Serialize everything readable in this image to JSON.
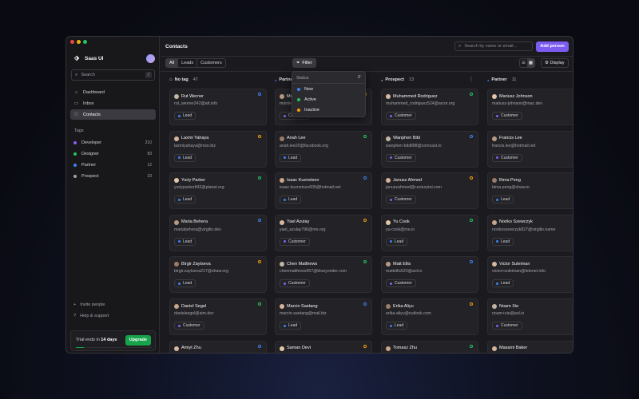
{
  "app": {
    "name": "Saas UI"
  },
  "colors": {
    "primary": "#7c5cf0",
    "upgrade": "#16a34a",
    "developer": "#8b5cf6",
    "designer": "#22c55e",
    "partner": "#3b82f6",
    "prospect": "#a1a1aa",
    "lead": "#3b82f6",
    "customer": "#8b5cf6",
    "status_new": "#3b82f6",
    "status_active": "#22c55e",
    "status_inactive": "#f59e0b"
  },
  "sidebar": {
    "search_placeholder": "Search",
    "search_shortcut": "/",
    "nav": [
      {
        "label": "Dashboard",
        "icon": "home-icon"
      },
      {
        "label": "Inbox",
        "icon": "inbox-icon"
      },
      {
        "label": "Contacts",
        "icon": "users-icon",
        "active": true
      }
    ],
    "tags_label": "Tags",
    "tags": [
      {
        "label": "Developer",
        "count": "210"
      },
      {
        "label": "Designer",
        "count": "83"
      },
      {
        "label": "Partner",
        "count": "12"
      },
      {
        "label": "Prospect",
        "count": "23"
      }
    ],
    "invite": "Invite people",
    "help": "Help & support",
    "trial_prefix": "Trial ends in",
    "trial_days": "14 days",
    "upgrade": "Upgrade",
    "trial_progress": 0.1
  },
  "header": {
    "title": "Contacts",
    "search_placeholder": "Search by name or email...",
    "add_button": "Add person"
  },
  "toolbar": {
    "segments": [
      "All",
      "Leads",
      "Customers"
    ],
    "filter": "Filter",
    "display": "Display"
  },
  "filter_menu": {
    "heading": "Status",
    "options": [
      "New",
      "Active",
      "Inactive"
    ]
  },
  "columns": [
    {
      "title": "No tag",
      "count": "47",
      "cards": [
        {
          "name": "Rut Werner",
          "email": "rut_werner242@att.info",
          "tag": "Lead"
        },
        {
          "name": "Laxmi Yahaya",
          "email": "laxmiyahaya@msn.biz",
          "tag": "Lead"
        },
        {
          "name": "Yuriy Parker",
          "email": "yuriyparker842@planet.org",
          "tag": "Lead"
        },
        {
          "name": "Maria Behera",
          "email": "mariabehera@virgilio.dev",
          "tag": "Lead"
        },
        {
          "name": "Birgir Zaytseva",
          "email": "birgir.zaytseva217@shaw.org",
          "tag": "Lead"
        },
        {
          "name": "Daniel Segel",
          "email": "danielsegel@aim.dev",
          "tag": "Customer"
        },
        {
          "name": "Amiyt Zhu",
          "email": "",
          "tag": ""
        }
      ]
    },
    {
      "title": "Partner",
      "count": "17",
      "cards": [
        {
          "name": "Mordechai Klein",
          "email": "mordechai-klein163@yandex.com",
          "tag": "Customer"
        },
        {
          "name": "Anah Lee",
          "email": "anah.lee20@facebook.org",
          "tag": "Lead"
        },
        {
          "name": "Isaac Kuznetsov",
          "email": "isaac-kuznetsov605@hotmail.net",
          "tag": "Lead"
        },
        {
          "name": "Yael Azulay",
          "email": "yael_azulay796@me.org",
          "tag": "Customer"
        },
        {
          "name": "Chen Matthews",
          "email": "chenmatthews657@blueyonder.com",
          "tag": "Customer"
        },
        {
          "name": "Marcin Saetang",
          "email": "marcin-saetang@mail.biz",
          "tag": "Lead"
        },
        {
          "name": "Saman Devi",
          "email": "",
          "tag": ""
        }
      ]
    },
    {
      "title": "Prospect",
      "count": "13",
      "cards": [
        {
          "name": "Muhammed Rodriguez",
          "email": "muhammed_rodriguez524@arcor.org",
          "tag": "Customer"
        },
        {
          "name": "Wanphen Bibi",
          "email": "wanphen-bibi898@comcast.io",
          "tag": "Customer"
        },
        {
          "name": "Janusz Ahmed",
          "email": "januszahmed@centurytel.com",
          "tag": "Customer"
        },
        {
          "name": "Yu Cook",
          "email": "yu-cook@me.io",
          "tag": "Lead"
        },
        {
          "name": "Matt Ellis",
          "email": "mattellis523@aol.io",
          "tag": "Customer"
        },
        {
          "name": "Erika Aliyu",
          "email": "erika-aliyu@outlook.com",
          "tag": "Lead"
        },
        {
          "name": "Tomasz Zhu",
          "email": "",
          "tag": ""
        }
      ]
    },
    {
      "title": "Partner",
      "count": "11",
      "cards": [
        {
          "name": "Mariusz Johnson",
          "email": "mariusz-johnson@mac.dev",
          "tag": "Customer"
        },
        {
          "name": "Francis Lee",
          "email": "francis.lee@hotmail.net",
          "tag": "Customer"
        },
        {
          "name": "Bima Peng",
          "email": "bima.peng@shaw.io",
          "tag": "Lead"
        },
        {
          "name": "Noriko Szewczyk",
          "email": "norikoszewczyk827@virgilio.name",
          "tag": "Lead"
        },
        {
          "name": "Victor Suleiman",
          "email": "victor+suleiman@telenet.info",
          "tag": "Lead"
        },
        {
          "name": "Noam Xie",
          "email": "noam+xie@aol.io",
          "tag": "Customer"
        },
        {
          "name": "Masami Baker",
          "email": "",
          "tag": ""
        }
      ]
    }
  ]
}
